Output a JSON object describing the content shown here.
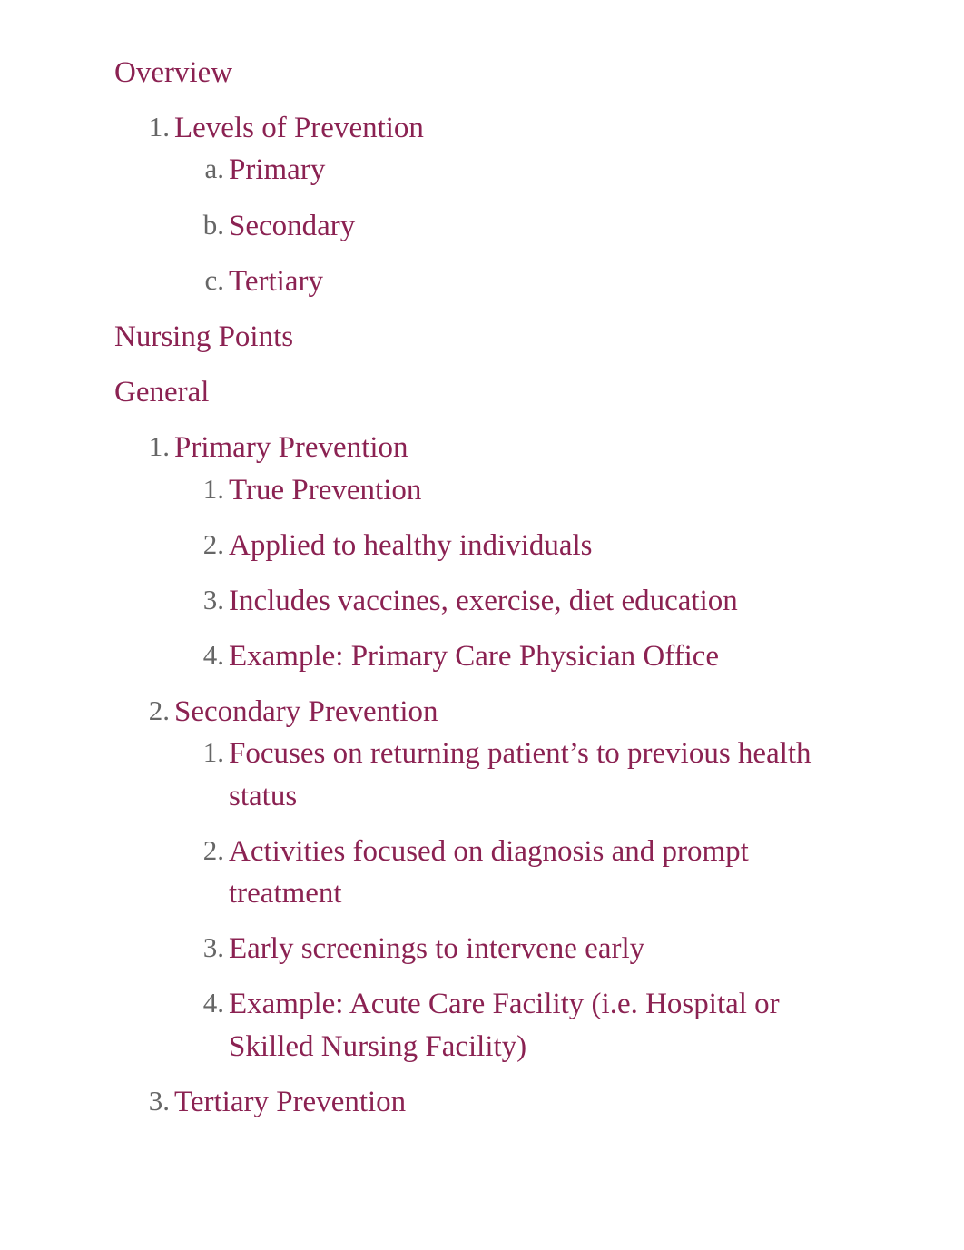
{
  "document": {
    "text_color": "#8B2252",
    "marker_color": "#666666",
    "background_color": "#FFFFFF",
    "sections": [
      {
        "heading": "Overview",
        "items": [
          {
            "marker": "1.",
            "text": "Levels of Prevention",
            "children": [
              {
                "marker": "a.",
                "text": "Primary"
              },
              {
                "marker": "b.",
                "text": "Secondary"
              },
              {
                "marker": "c.",
                "text": "Tertiary"
              }
            ]
          }
        ]
      },
      {
        "heading": "Nursing Points",
        "items": []
      },
      {
        "heading": "General",
        "items": [
          {
            "marker": "1.",
            "text": "Primary Prevention",
            "children": [
              {
                "marker": "1.",
                "text": "True Prevention"
              },
              {
                "marker": "2.",
                "text": "Applied to healthy individuals"
              },
              {
                "marker": "3.",
                "text": "Includes vaccines, exercise, diet education"
              },
              {
                "marker": "4.",
                "text": "Example: Primary Care Physician Office"
              }
            ]
          },
          {
            "marker": "2.",
            "text": "Secondary Prevention",
            "children": [
              {
                "marker": "1.",
                "text": "Focuses on returning patient’s to previous health status"
              },
              {
                "marker": "2.",
                "text": "Activities focused on diagnosis and prompt treatment"
              },
              {
                "marker": "3.",
                "text": "Early screenings to intervene early"
              },
              {
                "marker": "4.",
                "text": "Example: Acute Care Facility (i.e. Hospital or Skilled Nursing Facility)"
              }
            ]
          },
          {
            "marker": "3.",
            "text": "Tertiary Prevention",
            "children": []
          }
        ]
      }
    ]
  }
}
